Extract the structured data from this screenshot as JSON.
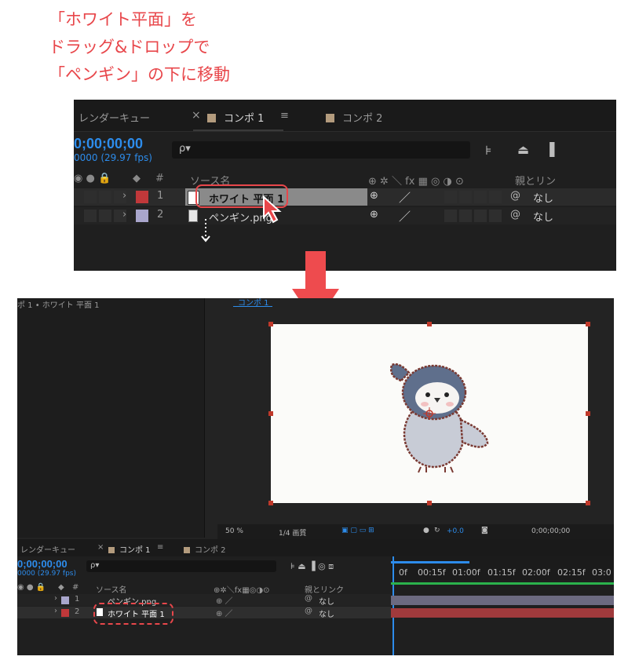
{
  "instruction": {
    "line1": "「ホワイト平面」を",
    "line2": "ドラッグ&ドロップで",
    "line3": "「ペンギン」の下に移動",
    "color": "#e8474b"
  },
  "before_panel": {
    "tabs": {
      "render_queue": "レンダーキュー",
      "close": "×",
      "comp1": "コンポ 1",
      "menu": "≡",
      "comp2": "コンポ 2"
    },
    "timecode": "0;00;00;00",
    "fps": "0000 (29.97 fps)",
    "search_icon": "ρ▾",
    "header": {
      "source_name": "ソース名",
      "switches": "⊕ ✲ ＼ fx ▦ ◎ ◑ ⊙",
      "parent": "親とリン"
    },
    "layers": [
      {
        "num": "1",
        "name": "ホワイト 平面 1",
        "color": "#c0383a",
        "parent": "なし"
      },
      {
        "num": "2",
        "name": "ペンギン.png",
        "color": "#a9a6cc",
        "parent": "なし"
      }
    ]
  },
  "after_panel": {
    "left_title": "ポ 1 • ホワイト 平面 1",
    "viewer_tab": "コンポ 1",
    "viewer_controls": {
      "zoom": "50 %",
      "resolution": "1/4 画質",
      "exposure": "+0.0",
      "timecode": "0;00;00;00"
    },
    "tabs": {
      "render_queue": "レンダーキュー",
      "close": "×",
      "comp1": "コンポ 1",
      "menu": "≡",
      "comp2": "コンポ 2"
    },
    "timecode": "0;00;00;00",
    "fps": "0000 (29.97 fps)",
    "search_icon": "ρ▾",
    "header": {
      "source_name": "ソース名",
      "switches": "⊕✲＼fx▦◎◑⊙",
      "parent": "親とリンク"
    },
    "ruler": [
      "0f",
      "00:15f",
      "01:00f",
      "01:15f",
      "02:00f",
      "02:15f",
      "03:0"
    ],
    "layers": [
      {
        "num": "1",
        "name": "ペンギン.png",
        "color": "#a9a6cc",
        "parent": "なし"
      },
      {
        "num": "2",
        "name": "ホワイト 平面 1",
        "color": "#c0383a",
        "parent": "なし"
      }
    ]
  },
  "colors": {
    "highlight": "#e8474b",
    "timecode_blue": "#2d8ceb",
    "solid_red": "#c0383a",
    "penguin_lavender": "#a9a6cc"
  }
}
